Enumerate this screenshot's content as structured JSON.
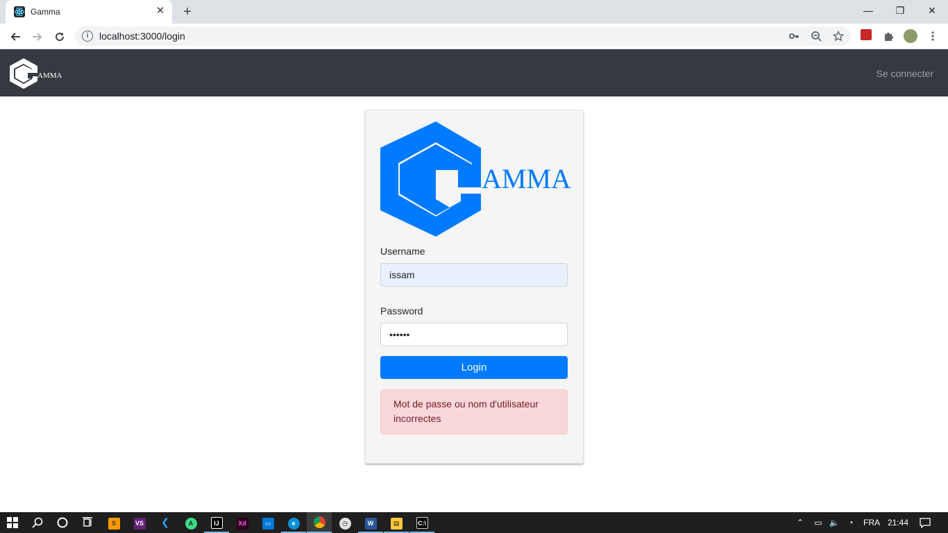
{
  "browser": {
    "tab_title": "Gamma",
    "url": "localhost:3000/login",
    "tab_close_glyph": "✕",
    "new_tab_glyph": "+",
    "window_controls": {
      "minimize": "—",
      "restore": "❐",
      "close": "✕"
    }
  },
  "navbar": {
    "brand_text": "AMMA",
    "link_label": "Se connecter",
    "bg_color": "#343a40"
  },
  "login": {
    "logo_text": "AMMA",
    "username_label": "Username",
    "username_value": "issam",
    "password_label": "Password",
    "password_value": "••••••",
    "submit_label": "Login",
    "error_message": "Mot de passe ou nom d'utilisateur incorrectes",
    "accent_color": "#007bff"
  },
  "taskbar": {
    "language": "FRA",
    "time": "21:44",
    "apps": [
      "windows-start",
      "search",
      "cortana",
      "task-view",
      "sublime-text",
      "visual-studio",
      "vscode",
      "android-studio",
      "intellij",
      "adobe-xd",
      "remote-desktop",
      "edge",
      "chrome",
      "clock-app",
      "word",
      "file-explorer",
      "terminal"
    ]
  }
}
